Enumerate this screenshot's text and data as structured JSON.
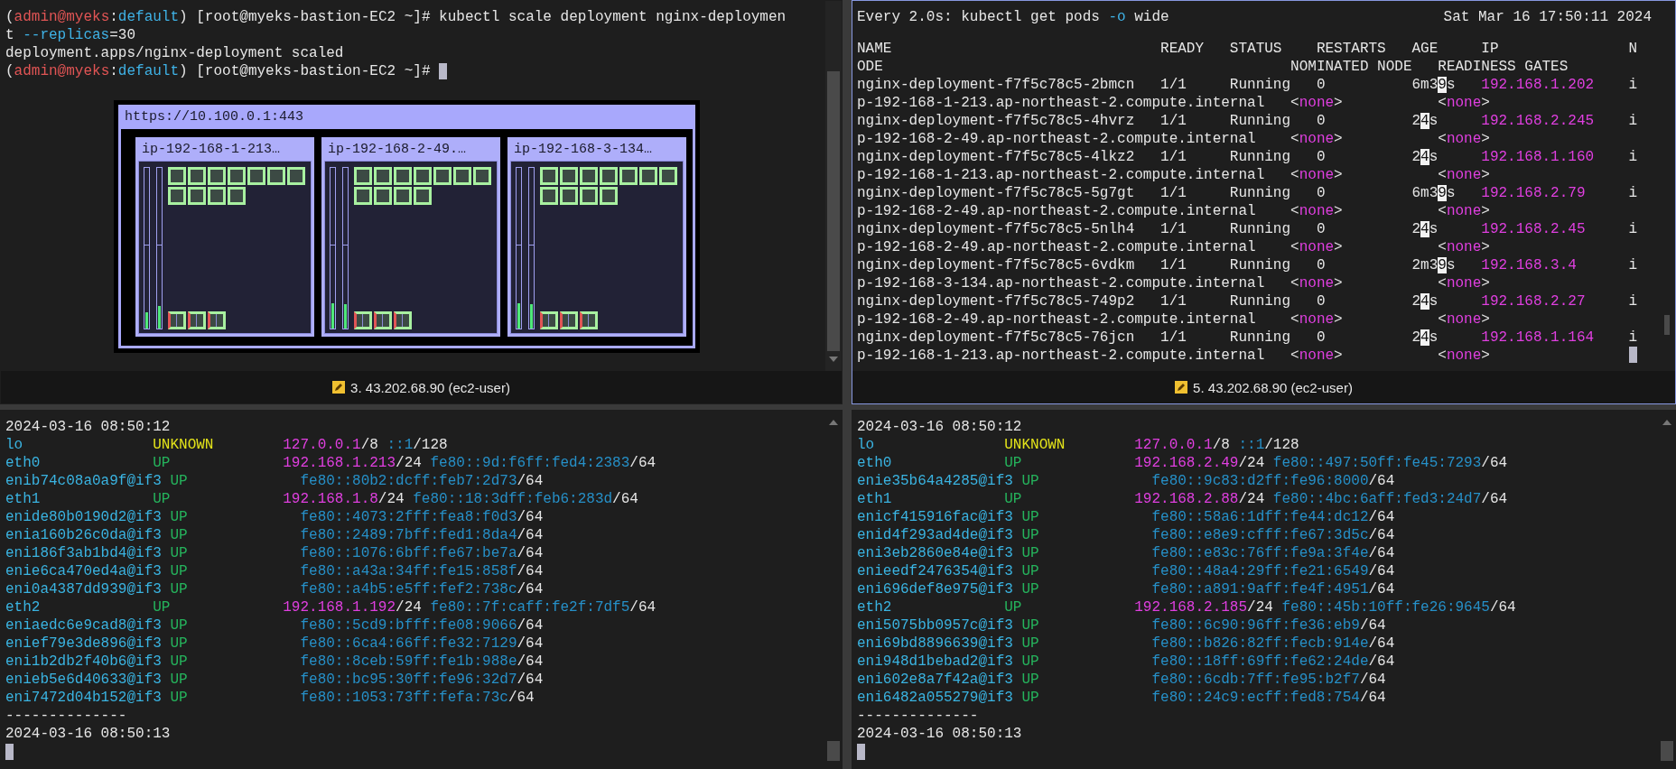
{
  "panes": [
    {
      "kind": "shell",
      "selected": false,
      "lines": [
        [
          {
            "text": "(",
            "kind": "plain"
          },
          {
            "text": "admin@myeks",
            "kind": "user"
          },
          {
            "text": ":",
            "kind": "plain"
          },
          {
            "text": "default",
            "kind": "namespace"
          },
          {
            "text": ") [root@myeks-bastion-EC2 ~]# kubectl scale deployment nginx-deploymen",
            "kind": "plain"
          }
        ],
        [
          {
            "text": "t ",
            "kind": "plain"
          },
          {
            "text": "--replicas",
            "kind": "flag"
          },
          {
            "text": "=30",
            "kind": "plain"
          }
        ],
        [
          {
            "text": "deployment.apps/nginx-deployment scaled",
            "kind": "plain"
          }
        ],
        [
          {
            "text": "(",
            "kind": "plain"
          },
          {
            "text": "admin@myeks",
            "kind": "user"
          },
          {
            "text": ":",
            "kind": "plain"
          },
          {
            "text": "default",
            "kind": "namespace"
          },
          {
            "text": ") [root@myeks-bastion-EC2 ~]# ",
            "kind": "plain"
          }
        ]
      ],
      "dashboard": {
        "title": "https://10.100.0.1:443",
        "nodes": [
          {
            "name": "ip-192-168-1-213…",
            "meters": [
              {
                "level": 0.1
              },
              {
                "level": 0.14
              }
            ],
            "pods": [
              {
                "kind": "app"
              },
              {
                "kind": "app"
              },
              {
                "kind": "app"
              },
              {
                "kind": "app"
              },
              {
                "kind": "app"
              },
              {
                "kind": "app"
              },
              {
                "kind": "app"
              },
              {
                "kind": "app"
              },
              {
                "kind": "app"
              },
              {
                "kind": "app"
              },
              {
                "kind": "app"
              }
            ],
            "system_pods": [
              {
                "kind": "system"
              },
              {
                "kind": "system"
              },
              {
                "kind": "system"
              }
            ]
          },
          {
            "name": "ip-192-168-2-49.…",
            "meters": [
              {
                "level": 0.16
              },
              {
                "level": 0.15
              }
            ],
            "pods": [
              {
                "kind": "app"
              },
              {
                "kind": "app"
              },
              {
                "kind": "app"
              },
              {
                "kind": "app"
              },
              {
                "kind": "app"
              },
              {
                "kind": "app"
              },
              {
                "kind": "app"
              },
              {
                "kind": "app"
              },
              {
                "kind": "app"
              },
              {
                "kind": "app"
              },
              {
                "kind": "app"
              }
            ],
            "system_pods": [
              {
                "kind": "system"
              },
              {
                "kind": "system"
              },
              {
                "kind": "system"
              }
            ]
          },
          {
            "name": "ip-192-168-3-134…",
            "meters": [
              {
                "level": 0.16
              },
              {
                "level": 0.15
              }
            ],
            "pods": [
              {
                "kind": "app"
              },
              {
                "kind": "app"
              },
              {
                "kind": "app"
              },
              {
                "kind": "app"
              },
              {
                "kind": "app"
              },
              {
                "kind": "app"
              },
              {
                "kind": "app"
              },
              {
                "kind": "app"
              },
              {
                "kind": "app"
              },
              {
                "kind": "app"
              },
              {
                "kind": "app"
              }
            ],
            "system_pods": [
              {
                "kind": "system"
              },
              {
                "kind": "system"
              },
              {
                "kind": "system"
              }
            ]
          }
        ]
      },
      "footer": "3. 43.202.68.90 (ec2-user)"
    },
    {
      "kind": "watch",
      "selected": true,
      "command": [
        {
          "text": "Every 2.0s: kubectl get pods ",
          "kind": "plain"
        },
        {
          "text": "-o",
          "kind": "flag"
        },
        {
          "text": " wide",
          "kind": "plain"
        }
      ],
      "time": "Sat Mar 16 17:50:11 2024",
      "columns": [
        "NAME",
        "READY",
        "STATUS",
        "RESTARTS",
        "AGE",
        "IP",
        "N"
      ],
      "columns_wrapped": [
        "ODE",
        "NOMINATED NODE",
        "READINESS GATES"
      ],
      "rows": [
        {
          "name": "nginx-deployment-f7f5c78c5-2bmcn",
          "ready": "1/1",
          "status": "Running",
          "restarts": "0",
          "age": [
            {
              "text": "6m3",
              "kind": "plain"
            },
            {
              "text": "9",
              "kind": "highlight"
            },
            {
              "text": "s",
              "kind": "plain"
            }
          ],
          "ip": "192.168.1.202",
          "node_start": "i",
          "node": "p-192-168-1-213.ap-northeast-2.compute.internal",
          "nominated": [
            {
              "text": "<",
              "kind": "plain"
            },
            {
              "text": "none",
              "kind": "value"
            },
            {
              "text": ">",
              "kind": "plain"
            }
          ],
          "readiness": [
            {
              "text": "<",
              "kind": "plain"
            },
            {
              "text": "none",
              "kind": "value"
            },
            {
              "text": ">",
              "kind": "plain"
            }
          ]
        },
        {
          "name": "nginx-deployment-f7f5c78c5-4hvrz",
          "ready": "1/1",
          "status": "Running",
          "restarts": "0",
          "age": [
            {
              "text": "2",
              "kind": "plain"
            },
            {
              "text": "4",
              "kind": "highlight"
            },
            {
              "text": "s",
              "kind": "plain"
            }
          ],
          "ip": "192.168.2.245",
          "node_start": "i",
          "node": "p-192-168-2-49.ap-northeast-2.compute.internal",
          "nominated": [
            {
              "text": "<",
              "kind": "plain"
            },
            {
              "text": "none",
              "kind": "value"
            },
            {
              "text": ">",
              "kind": "plain"
            }
          ],
          "readiness": [
            {
              "text": "<",
              "kind": "plain"
            },
            {
              "text": "none",
              "kind": "value"
            },
            {
              "text": ">",
              "kind": "plain"
            }
          ]
        },
        {
          "name": "nginx-deployment-f7f5c78c5-4lkz2",
          "ready": "1/1",
          "status": "Running",
          "restarts": "0",
          "age": [
            {
              "text": "2",
              "kind": "plain"
            },
            {
              "text": "4",
              "kind": "highlight"
            },
            {
              "text": "s",
              "kind": "plain"
            }
          ],
          "ip": "192.168.1.160",
          "node_start": "i",
          "node": "p-192-168-1-213.ap-northeast-2.compute.internal",
          "nominated": [
            {
              "text": "<",
              "kind": "plain"
            },
            {
              "text": "none",
              "kind": "value"
            },
            {
              "text": ">",
              "kind": "plain"
            }
          ],
          "readiness": [
            {
              "text": "<",
              "kind": "plain"
            },
            {
              "text": "none",
              "kind": "value"
            },
            {
              "text": ">",
              "kind": "plain"
            }
          ]
        },
        {
          "name": "nginx-deployment-f7f5c78c5-5g7gt",
          "ready": "1/1",
          "status": "Running",
          "restarts": "0",
          "age": [
            {
              "text": "6m3",
              "kind": "plain"
            },
            {
              "text": "9",
              "kind": "highlight"
            },
            {
              "text": "s",
              "kind": "plain"
            }
          ],
          "ip": "192.168.2.79",
          "node_start": "i",
          "node": "p-192-168-2-49.ap-northeast-2.compute.internal",
          "nominated": [
            {
              "text": "<",
              "kind": "plain"
            },
            {
              "text": "none",
              "kind": "value"
            },
            {
              "text": ">",
              "kind": "plain"
            }
          ],
          "readiness": [
            {
              "text": "<",
              "kind": "plain"
            },
            {
              "text": "none",
              "kind": "value"
            },
            {
              "text": ">",
              "kind": "plain"
            }
          ]
        },
        {
          "name": "nginx-deployment-f7f5c78c5-5nlh4",
          "ready": "1/1",
          "status": "Running",
          "restarts": "0",
          "age": [
            {
              "text": "2",
              "kind": "plain"
            },
            {
              "text": "4",
              "kind": "highlight"
            },
            {
              "text": "s",
              "kind": "plain"
            }
          ],
          "ip": "192.168.2.45",
          "node_start": "i",
          "node": "p-192-168-2-49.ap-northeast-2.compute.internal",
          "nominated": [
            {
              "text": "<",
              "kind": "plain"
            },
            {
              "text": "none",
              "kind": "value"
            },
            {
              "text": ">",
              "kind": "plain"
            }
          ],
          "readiness": [
            {
              "text": "<",
              "kind": "plain"
            },
            {
              "text": "none",
              "kind": "value"
            },
            {
              "text": ">",
              "kind": "plain"
            }
          ]
        },
        {
          "name": "nginx-deployment-f7f5c78c5-6vdkm",
          "ready": "1/1",
          "status": "Running",
          "restarts": "0",
          "age": [
            {
              "text": "2m3",
              "kind": "plain"
            },
            {
              "text": "9",
              "kind": "highlight"
            },
            {
              "text": "s",
              "kind": "plain"
            }
          ],
          "ip": "192.168.3.4",
          "node_start": "i",
          "node": "p-192-168-3-134.ap-northeast-2.compute.internal",
          "nominated": [
            {
              "text": "<",
              "kind": "plain"
            },
            {
              "text": "none",
              "kind": "value"
            },
            {
              "text": ">",
              "kind": "plain"
            }
          ],
          "readiness": [
            {
              "text": "<",
              "kind": "plain"
            },
            {
              "text": "none",
              "kind": "value"
            },
            {
              "text": ">",
              "kind": "plain"
            }
          ]
        },
        {
          "name": "nginx-deployment-f7f5c78c5-749p2",
          "ready": "1/1",
          "status": "Running",
          "restarts": "0",
          "age": [
            {
              "text": "2",
              "kind": "plain"
            },
            {
              "text": "4",
              "kind": "highlight"
            },
            {
              "text": "s",
              "kind": "plain"
            }
          ],
          "ip": "192.168.2.27",
          "node_start": "i",
          "node": "p-192-168-2-49.ap-northeast-2.compute.internal",
          "nominated": [
            {
              "text": "<",
              "kind": "plain"
            },
            {
              "text": "none",
              "kind": "value"
            },
            {
              "text": ">",
              "kind": "plain"
            }
          ],
          "readiness": [
            {
              "text": "<",
              "kind": "plain"
            },
            {
              "text": "none",
              "kind": "value"
            },
            {
              "text": ">",
              "kind": "plain"
            }
          ]
        },
        {
          "name": "nginx-deployment-f7f5c78c5-76jcn",
          "ready": "1/1",
          "status": "Running",
          "restarts": "0",
          "age": [
            {
              "text": "2",
              "kind": "plain"
            },
            {
              "text": "4",
              "kind": "highlight"
            },
            {
              "text": "s",
              "kind": "plain"
            }
          ],
          "ip": "192.168.1.164",
          "node_start": "i",
          "node": "p-192-168-1-213.ap-northeast-2.compute.internal",
          "nominated": [
            {
              "text": "<",
              "kind": "plain"
            },
            {
              "text": "none",
              "kind": "value"
            },
            {
              "text": ">",
              "kind": "plain"
            }
          ],
          "readiness": [
            {
              "text": "<",
              "kind": "plain"
            },
            {
              "text": "none",
              "kind": "value"
            },
            {
              "text": ">",
              "kind": "plain"
            }
          ]
        }
      ],
      "footer": "5. 43.202.68.90 (ec2-user)"
    },
    {
      "kind": "ipaddr",
      "selected": false,
      "timestamp": "2024-03-16 08:50:12",
      "interfaces": [
        {
          "name": "lo",
          "state": {
            "text": "UNKNOWN",
            "kind": "unknown"
          },
          "addresses": [
            {
              "address": "127.0.0.1",
              "prefix": "/8",
              "kind": "ipv4"
            },
            {
              "address": "::1",
              "prefix": "/128",
              "kind": "ipv6"
            }
          ]
        },
        {
          "name": "eth0",
          "state": {
            "text": "UP",
            "kind": "up"
          },
          "addresses": [
            {
              "address": "192.168.1.213",
              "prefix": "/24",
              "kind": "ipv4"
            },
            {
              "address": "fe80::9d:f6ff:fed4:2383",
              "prefix": "/64",
              "kind": "ipv6"
            }
          ]
        },
        {
          "name": "enib74c08a0a9f@if3",
          "state": {
            "text": "UP",
            "kind": "up"
          },
          "addresses": [
            {
              "address": "fe80::80b2:dcff:feb7:2d73",
              "prefix": "/64",
              "kind": "ipv6"
            }
          ]
        },
        {
          "name": "eth1",
          "state": {
            "text": "UP",
            "kind": "up"
          },
          "addresses": [
            {
              "address": "192.168.1.8",
              "prefix": "/24",
              "kind": "ipv4"
            },
            {
              "address": "fe80::18:3dff:feb6:283d",
              "prefix": "/64",
              "kind": "ipv6"
            }
          ]
        },
        {
          "name": "enide80b0190d2@if3",
          "state": {
            "text": "UP",
            "kind": "up"
          },
          "addresses": [
            {
              "address": "fe80::4073:2fff:fea8:f0d3",
              "prefix": "/64",
              "kind": "ipv6"
            }
          ]
        },
        {
          "name": "enia160b26c0da@if3",
          "state": {
            "text": "UP",
            "kind": "up"
          },
          "addresses": [
            {
              "address": "fe80::2489:7bff:fed1:8da4",
              "prefix": "/64",
              "kind": "ipv6"
            }
          ]
        },
        {
          "name": "eni186f3ab1bd4@if3",
          "state": {
            "text": "UP",
            "kind": "up"
          },
          "addresses": [
            {
              "address": "fe80::1076:6bff:fe67:be7a",
              "prefix": "/64",
              "kind": "ipv6"
            }
          ]
        },
        {
          "name": "enie6ca470ed4a@if3",
          "state": {
            "text": "UP",
            "kind": "up"
          },
          "addresses": [
            {
              "address": "fe80::a43a:34ff:fe15:858f",
              "prefix": "/64",
              "kind": "ipv6"
            }
          ]
        },
        {
          "name": "eni0a4387dd939@if3",
          "state": {
            "text": "UP",
            "kind": "up"
          },
          "addresses": [
            {
              "address": "fe80::a4b5:e5ff:fef2:738c",
              "prefix": "/64",
              "kind": "ipv6"
            }
          ]
        },
        {
          "name": "eth2",
          "state": {
            "text": "UP",
            "kind": "up"
          },
          "addresses": [
            {
              "address": "192.168.1.192",
              "prefix": "/24",
              "kind": "ipv4"
            },
            {
              "address": "fe80::7f:caff:fe2f:7df5",
              "prefix": "/64",
              "kind": "ipv6"
            }
          ]
        },
        {
          "name": "eniaedc6e9cad8@if3",
          "state": {
            "text": "UP",
            "kind": "up"
          },
          "addresses": [
            {
              "address": "fe80::5cd9:bfff:fe08:9066",
              "prefix": "/64",
              "kind": "ipv6"
            }
          ]
        },
        {
          "name": "enief79e3de896@if3",
          "state": {
            "text": "UP",
            "kind": "up"
          },
          "addresses": [
            {
              "address": "fe80::6ca4:66ff:fe32:7129",
              "prefix": "/64",
              "kind": "ipv6"
            }
          ]
        },
        {
          "name": "eni1b2db2f40b6@if3",
          "state": {
            "text": "UP",
            "kind": "up"
          },
          "addresses": [
            {
              "address": "fe80::8ceb:59ff:fe1b:988e",
              "prefix": "/64",
              "kind": "ipv6"
            }
          ]
        },
        {
          "name": "enieb5e6d40633@if3",
          "state": {
            "text": "UP",
            "kind": "up"
          },
          "addresses": [
            {
              "address": "fe80::bc95:30ff:fe96:32d7",
              "prefix": "/64",
              "kind": "ipv6"
            }
          ]
        },
        {
          "name": "eni7472d04b152@if3",
          "state": {
            "text": "UP",
            "kind": "up"
          },
          "addresses": [
            {
              "address": "fe80::1053:73ff:fefa:73c",
              "prefix": "/64",
              "kind": "ipv6"
            }
          ]
        }
      ],
      "separator": "--------------",
      "next_timestamp": "2024-03-16 08:50:13"
    },
    {
      "kind": "ipaddr",
      "selected": false,
      "timestamp": "2024-03-16 08:50:12",
      "interfaces": [
        {
          "name": "lo",
          "state": {
            "text": "UNKNOWN",
            "kind": "unknown"
          },
          "addresses": [
            {
              "address": "127.0.0.1",
              "prefix": "/8",
              "kind": "ipv4"
            },
            {
              "address": "::1",
              "prefix": "/128",
              "kind": "ipv6"
            }
          ]
        },
        {
          "name": "eth0",
          "state": {
            "text": "UP",
            "kind": "up"
          },
          "addresses": [
            {
              "address": "192.168.2.49",
              "prefix": "/24",
              "kind": "ipv4"
            },
            {
              "address": "fe80::497:50ff:fe45:7293",
              "prefix": "/64",
              "kind": "ipv6"
            }
          ]
        },
        {
          "name": "enie35b64a4285@if3",
          "state": {
            "text": "UP",
            "kind": "up"
          },
          "addresses": [
            {
              "address": "fe80::9c83:d2ff:fe96:8000",
              "prefix": "/64",
              "kind": "ipv6"
            }
          ]
        },
        {
          "name": "eth1",
          "state": {
            "text": "UP",
            "kind": "up"
          },
          "addresses": [
            {
              "address": "192.168.2.88",
              "prefix": "/24",
              "kind": "ipv4"
            },
            {
              "address": "fe80::4bc:6aff:fed3:24d7",
              "prefix": "/64",
              "kind": "ipv6"
            }
          ]
        },
        {
          "name": "enicf415916fac@if3",
          "state": {
            "text": "UP",
            "kind": "up"
          },
          "addresses": [
            {
              "address": "fe80::58a6:1dff:fe44:dc12",
              "prefix": "/64",
              "kind": "ipv6"
            }
          ]
        },
        {
          "name": "enid4f293ad4de@if3",
          "state": {
            "text": "UP",
            "kind": "up"
          },
          "addresses": [
            {
              "address": "fe80::e8e9:cfff:fe67:3d5c",
              "prefix": "/64",
              "kind": "ipv6"
            }
          ]
        },
        {
          "name": "eni3eb2860e84e@if3",
          "state": {
            "text": "UP",
            "kind": "up"
          },
          "addresses": [
            {
              "address": "fe80::e83c:76ff:fe9a:3f4e",
              "prefix": "/64",
              "kind": "ipv6"
            }
          ]
        },
        {
          "name": "enieedf2476354@if3",
          "state": {
            "text": "UP",
            "kind": "up"
          },
          "addresses": [
            {
              "address": "fe80::48a4:29ff:fe21:6549",
              "prefix": "/64",
              "kind": "ipv6"
            }
          ]
        },
        {
          "name": "eni696def8e975@if3",
          "state": {
            "text": "UP",
            "kind": "up"
          },
          "addresses": [
            {
              "address": "fe80::a891:9aff:fe4f:4951",
              "prefix": "/64",
              "kind": "ipv6"
            }
          ]
        },
        {
          "name": "eth2",
          "state": {
            "text": "UP",
            "kind": "up"
          },
          "addresses": [
            {
              "address": "192.168.2.185",
              "prefix": "/24",
              "kind": "ipv4"
            },
            {
              "address": "fe80::45b:10ff:fe26:9645",
              "prefix": "/64",
              "kind": "ipv6"
            }
          ]
        },
        {
          "name": "eni5075bb0957c@if3",
          "state": {
            "text": "UP",
            "kind": "up"
          },
          "addresses": [
            {
              "address": "fe80::6c90:96ff:fe36:eb9",
              "prefix": "/64",
              "kind": "ipv6"
            }
          ]
        },
        {
          "name": "eni69bd8896639@if3",
          "state": {
            "text": "UP",
            "kind": "up"
          },
          "addresses": [
            {
              "address": "fe80::b826:82ff:fecb:914e",
              "prefix": "/64",
              "kind": "ipv6"
            }
          ]
        },
        {
          "name": "eni948d1bebad2@if3",
          "state": {
            "text": "UP",
            "kind": "up"
          },
          "addresses": [
            {
              "address": "fe80::18ff:69ff:fe62:24de",
              "prefix": "/64",
              "kind": "ipv6"
            }
          ]
        },
        {
          "name": "eni602e8a7f42a@if3",
          "state": {
            "text": "UP",
            "kind": "up"
          },
          "addresses": [
            {
              "address": "fe80::6cdb:7ff:fe95:b2f7",
              "prefix": "/64",
              "kind": "ipv6"
            }
          ]
        },
        {
          "name": "eni6482a055279@if3",
          "state": {
            "text": "UP",
            "kind": "up"
          },
          "addresses": [
            {
              "address": "fe80::24c9:ecff:fed8:754",
              "prefix": "/64",
              "kind": "ipv6"
            }
          ]
        }
      ],
      "separator": "--------------",
      "next_timestamp": "2024-03-16 08:50:13"
    }
  ]
}
